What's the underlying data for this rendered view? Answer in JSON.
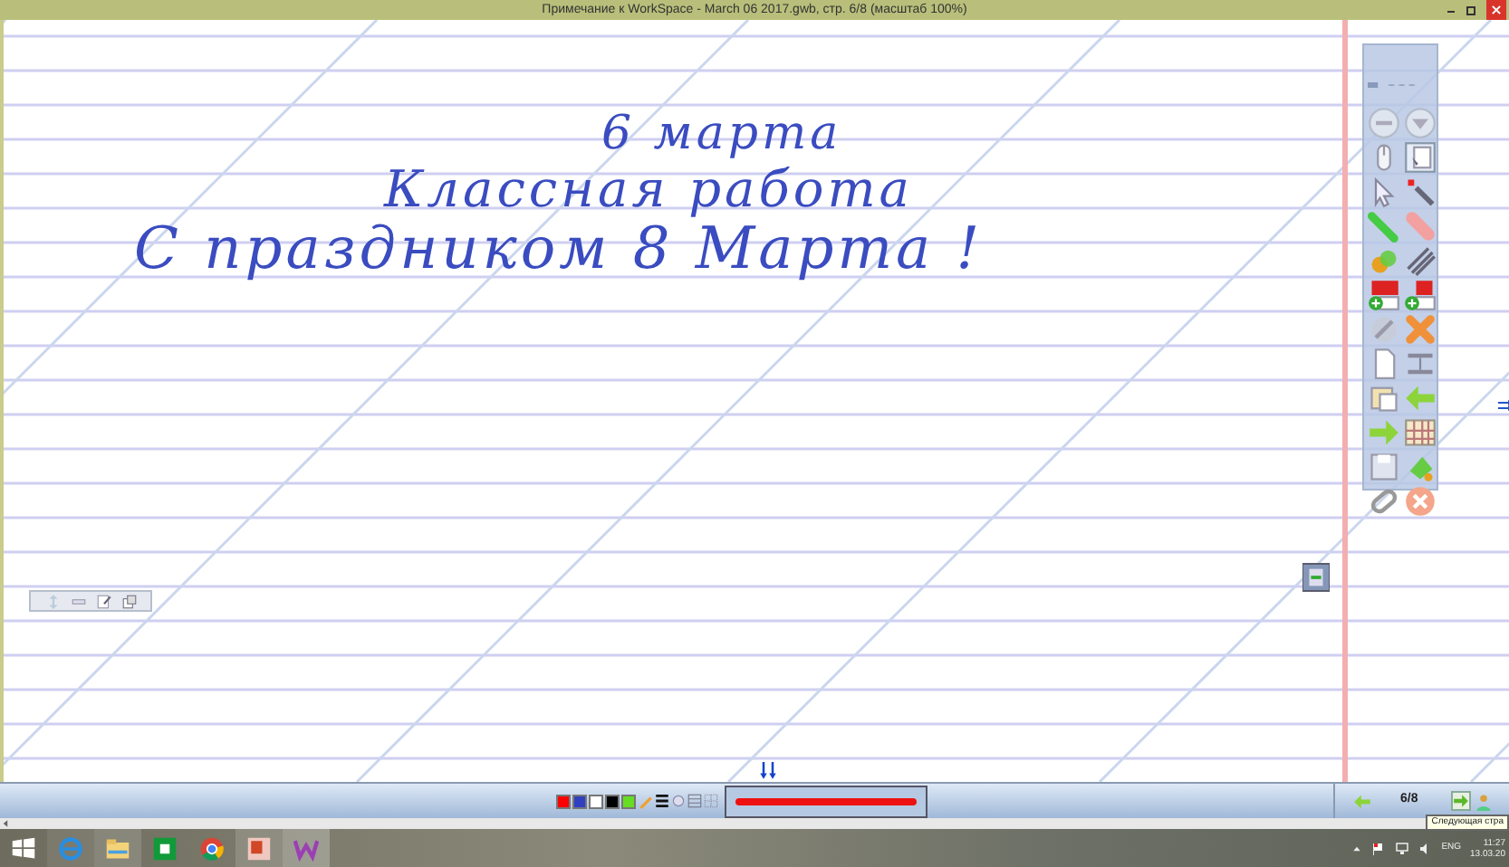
{
  "window": {
    "title": "Примечание к WorkSpace - March 06 2017.gwb, стр. 6/8 (масштаб 100%)"
  },
  "board": {
    "lines": [
      "6 марта",
      "Классная работа",
      "С праздником 8 Марта !"
    ]
  },
  "bottom_bar": {
    "palette": [
      {
        "color": "#ff0000"
      },
      {
        "color": "#3040c0"
      },
      {
        "color": "#ffffff"
      },
      {
        "color": "#000000"
      },
      {
        "color": "#66dd22"
      }
    ],
    "pen": {
      "color": "#ee1111"
    },
    "page": "6/8",
    "tooltip": "Следующая стра"
  },
  "taskbar": {
    "language": "ENG",
    "time": "11:27",
    "date": "13.03.20"
  }
}
